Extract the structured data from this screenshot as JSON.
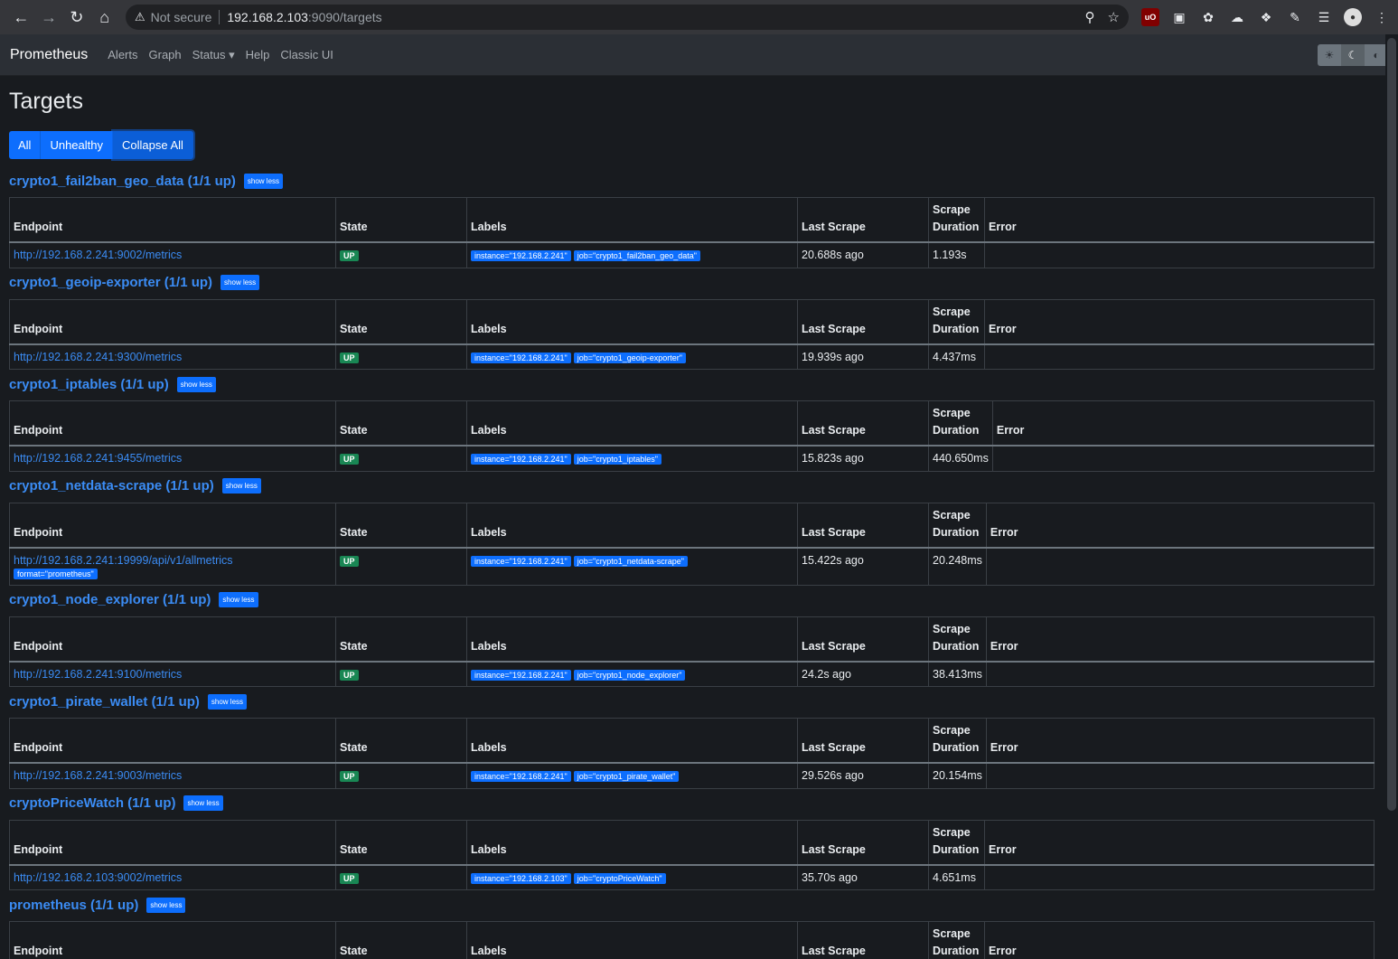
{
  "browser": {
    "not_secure": "Not secure",
    "url_host": "192.168.2.103",
    "url_rest": ":9090/targets"
  },
  "navbar": {
    "brand": "Prometheus",
    "links": [
      "Alerts",
      "Graph",
      "Status ▾",
      "Help",
      "Classic UI"
    ]
  },
  "page": {
    "title": "Targets",
    "filters": [
      "All",
      "Unhealthy",
      "Collapse All"
    ]
  },
  "columns": [
    "Endpoint",
    "State",
    "Labels",
    "Last Scrape",
    "Scrape Duration",
    "Error"
  ],
  "show_less_label": "show less",
  "pools": [
    {
      "title": "crypto1_fail2ban_geo_data (1/1 up)",
      "endpoint": "http://192.168.2.241:9002/metrics",
      "state": "UP",
      "labels": [
        "instance=\"192.168.2.241\"",
        "job=\"crypto1_fail2ban_geo_data\""
      ],
      "last_scrape": "20.688s ago",
      "duration": "1.193s",
      "error": ""
    },
    {
      "title": "crypto1_geoip-exporter (1/1 up)",
      "endpoint": "http://192.168.2.241:9300/metrics",
      "state": "UP",
      "labels": [
        "instance=\"192.168.2.241\"",
        "job=\"crypto1_geoip-exporter\""
      ],
      "last_scrape": "19.939s ago",
      "duration": "4.437ms",
      "error": ""
    },
    {
      "title": "crypto1_iptables (1/1 up)",
      "endpoint": "http://192.168.2.241:9455/metrics",
      "state": "UP",
      "labels": [
        "instance=\"192.168.2.241\"",
        "job=\"crypto1_iptables\""
      ],
      "last_scrape": "15.823s ago",
      "duration": "440.650ms",
      "error": ""
    },
    {
      "title": "crypto1_netdata-scrape (1/1 up)",
      "endpoint": "http://192.168.2.241:19999/api/v1/allmetrics",
      "endpoint_param": "format=\"prometheus\"",
      "state": "UP",
      "labels": [
        "instance=\"192.168.2.241\"",
        "job=\"crypto1_netdata-scrape\""
      ],
      "last_scrape": "15.422s ago",
      "duration": "20.248ms",
      "error": ""
    },
    {
      "title": "crypto1_node_explorer (1/1 up)",
      "endpoint": "http://192.168.2.241:9100/metrics",
      "state": "UP",
      "labels": [
        "instance=\"192.168.2.241\"",
        "job=\"crypto1_node_explorer\""
      ],
      "last_scrape": "24.2s ago",
      "duration": "38.413ms",
      "error": ""
    },
    {
      "title": "crypto1_pirate_wallet (1/1 up)",
      "endpoint": "http://192.168.2.241:9003/metrics",
      "state": "UP",
      "labels": [
        "instance=\"192.168.2.241\"",
        "job=\"crypto1_pirate_wallet\""
      ],
      "last_scrape": "29.526s ago",
      "duration": "20.154ms",
      "error": ""
    },
    {
      "title": "cryptoPriceWatch (1/1 up)",
      "endpoint": "http://192.168.2.103:9002/metrics",
      "state": "UP",
      "labels": [
        "instance=\"192.168.2.103\"",
        "job=\"cryptoPriceWatch\""
      ],
      "last_scrape": "35.70s ago",
      "duration": "4.651ms",
      "error": ""
    },
    {
      "title": "prometheus (1/1 up)",
      "partial": true
    }
  ]
}
